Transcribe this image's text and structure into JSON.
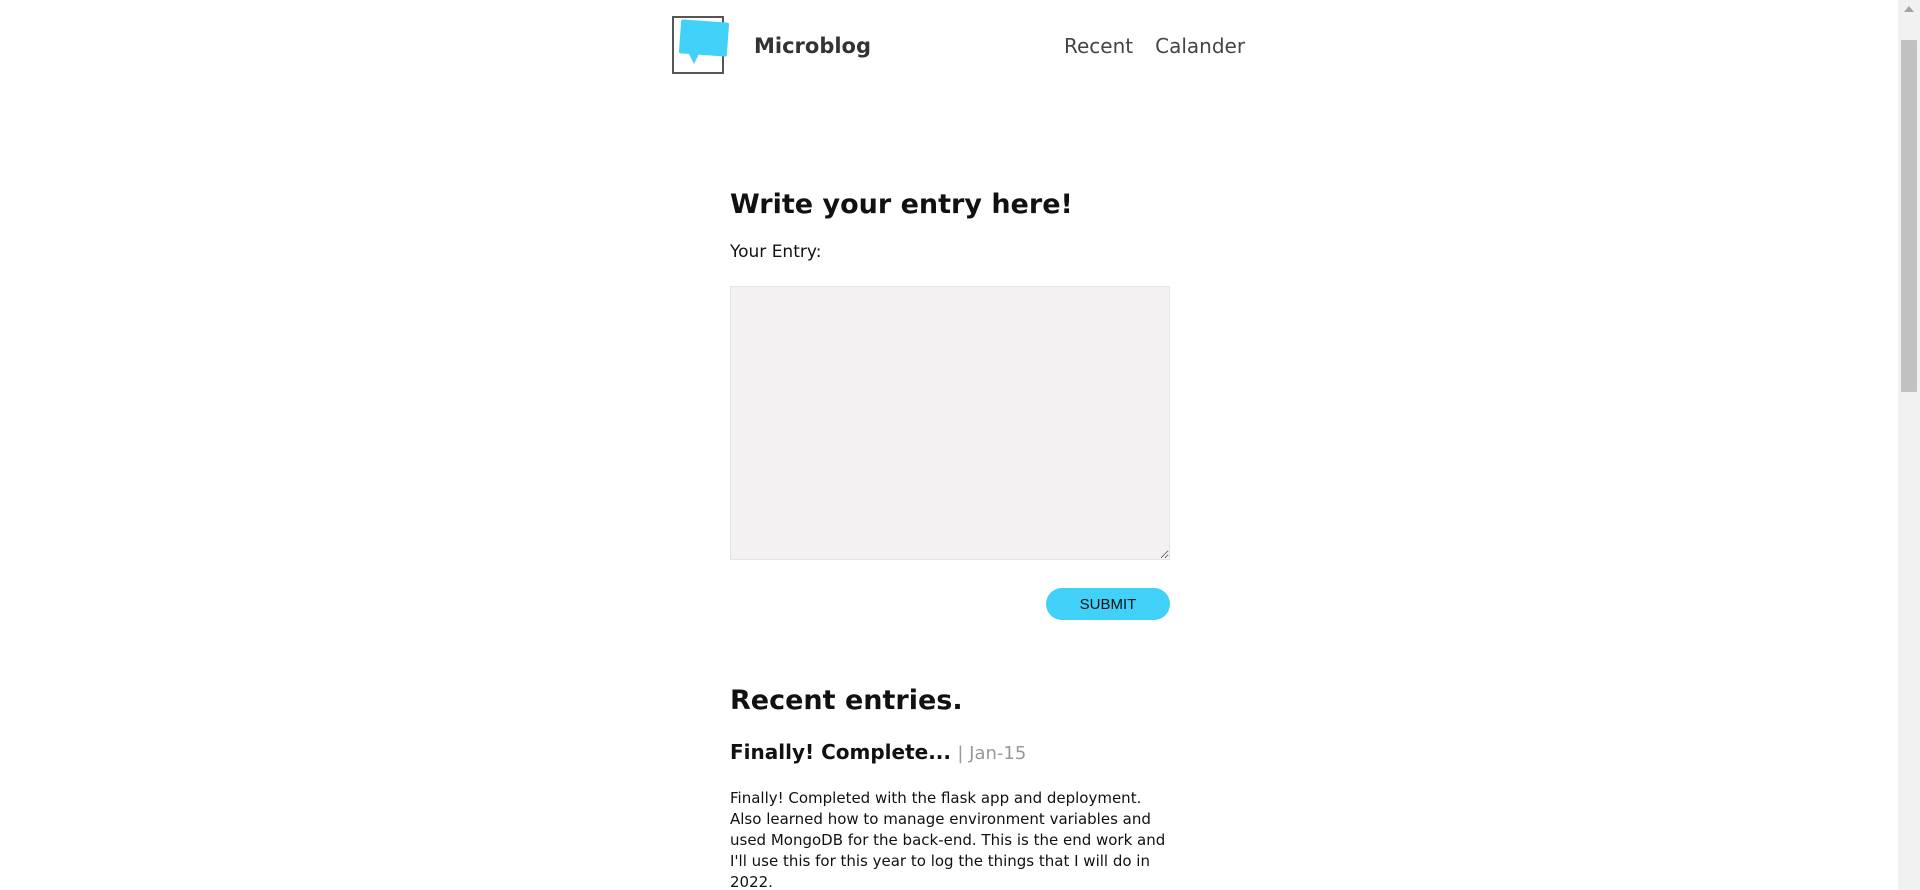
{
  "header": {
    "site_title": "Microblog",
    "nav": [
      {
        "label": "Recent"
      },
      {
        "label": "Calander"
      }
    ]
  },
  "form": {
    "title": "Write your entry here!",
    "entry_label": "Your Entry:",
    "entry_value": "",
    "submit_label": "SUBMIT"
  },
  "recent": {
    "title": "Recent entries.",
    "entries": [
      {
        "title": "Finally! Complete...",
        "date": "| Jan-15",
        "body": "Finally! Completed with the flask app and deployment. Also learned how to manage environment variables and used MongoDB for the back-end. This is the end work and I'll use this for this year to log the things that I will do in 2022."
      }
    ]
  },
  "colors": {
    "accent": "#40d0f8",
    "textarea_bg": "#f3f1f1",
    "date_text": "#999999"
  },
  "icons": {
    "logo": "speech-bubble-logo-icon",
    "scroll_up": "chevron-up-icon"
  }
}
